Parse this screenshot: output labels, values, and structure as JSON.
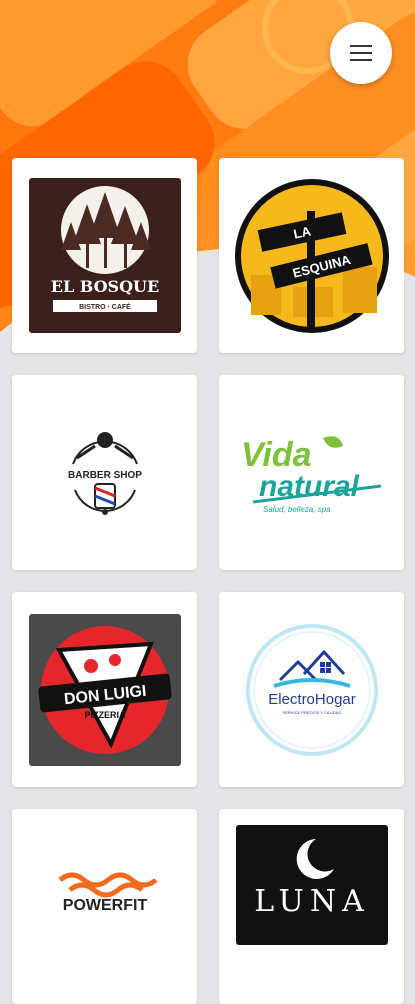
{
  "businesses": [
    {
      "name": "EL BOSQUE",
      "tagline": "BISTRO · CAFÉ"
    },
    {
      "name_line1": "LA",
      "name_line2": "ESQUINA"
    },
    {
      "name": "BARBER SHOP"
    },
    {
      "name_line1": "Vida",
      "name_line2": "natural",
      "tagline": "Salud, belleza, spa"
    },
    {
      "name": "DON LUIGI",
      "tagline": "PIZZERIA"
    },
    {
      "name": "ElectroHogar",
      "tagline": "SERVICE PRECIOS Y CALIDAD"
    },
    {
      "name": "POWERFIT"
    },
    {
      "name": "LUNA"
    }
  ],
  "colors": {
    "accent": "#ff7a10",
    "background": "#e5e4e6"
  }
}
